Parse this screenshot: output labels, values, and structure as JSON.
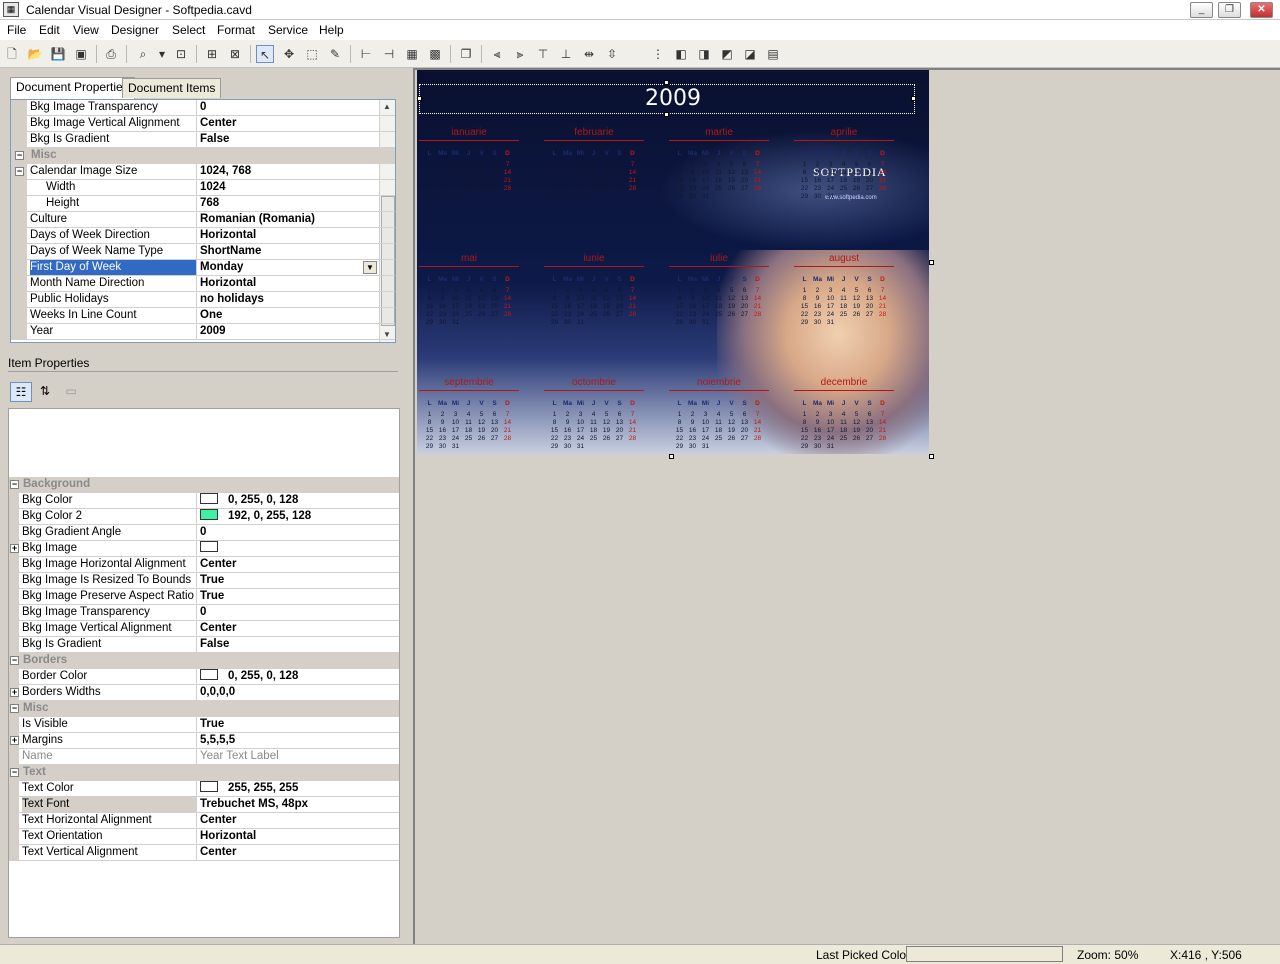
{
  "window": {
    "title": "Calendar Visual Designer - Softpedia.cavd",
    "minimize": "_",
    "maximize": "❐",
    "close": "✕"
  },
  "menu": [
    "File",
    "Edit",
    "View",
    "Designer",
    "Select",
    "Format",
    "Service",
    "Help"
  ],
  "tabs": {
    "doc_props": "Document Properties",
    "doc_items": "Document Items"
  },
  "doc_props": [
    {
      "name": "Bkg Image Transparency",
      "value": "0"
    },
    {
      "name": "Bkg Image Vertical Alignment",
      "value": "Center"
    },
    {
      "name": "Bkg Is Gradient",
      "value": "False"
    },
    {
      "name": "Misc",
      "category": true
    },
    {
      "name": "Calendar Image Size",
      "value": "1024, 768"
    },
    {
      "name": "Width",
      "value": "1024"
    },
    {
      "name": "Height",
      "value": "768"
    },
    {
      "name": "Culture",
      "value": "Romanian (Romania)"
    },
    {
      "name": "Days of Week Direction",
      "value": "Horizontal"
    },
    {
      "name": "Days of Week Name Type",
      "value": "ShortName"
    },
    {
      "name": "First Day of Week",
      "value": "Monday"
    },
    {
      "name": "Month Name Direction",
      "value": "Horizontal"
    },
    {
      "name": "Public Holidays",
      "value": "no holidays"
    },
    {
      "name": "Weeks In Line Count",
      "value": "One"
    },
    {
      "name": "Year",
      "value": "2009"
    }
  ],
  "item_props_label": "Item Properties",
  "item_props": [
    {
      "name": "Background",
      "category": true
    },
    {
      "name": "Bkg Color",
      "value": "0, 255, 0, 128",
      "swatch": "#ffffff"
    },
    {
      "name": "Bkg Color 2",
      "value": "192, 0, 255, 128",
      "swatch": "#40f0a0"
    },
    {
      "name": "Bkg Gradient Angle",
      "value": "0"
    },
    {
      "name": "Bkg Image",
      "value": "",
      "swatch": "#ffffff"
    },
    {
      "name": "Bkg Image Horizontal Alignment",
      "value": "Center"
    },
    {
      "name": "Bkg Image Is Resized To Bounds",
      "value": "True"
    },
    {
      "name": "Bkg Image Preserve Aspect Ratio",
      "value": "True"
    },
    {
      "name": "Bkg Image Transparency",
      "value": "0"
    },
    {
      "name": "Bkg Image Vertical Alignment",
      "value": "Center"
    },
    {
      "name": "Bkg Is Gradient",
      "value": "False"
    },
    {
      "name": "Borders",
      "category": true
    },
    {
      "name": "Border Color",
      "value": "0, 255, 0, 128",
      "swatch": "#ffffff"
    },
    {
      "name": "Borders Widths",
      "value": "0,0,0,0"
    },
    {
      "name": "Misc",
      "category": true
    },
    {
      "name": "Is Visible",
      "value": "True"
    },
    {
      "name": "Margins",
      "value": "5,5,5,5"
    },
    {
      "name": "Name",
      "value": "Year Text Label"
    },
    {
      "name": "Text",
      "category": true
    },
    {
      "name": "Text Color",
      "value": "255, 255, 255",
      "swatch": "#ffffff"
    },
    {
      "name": "Text Font",
      "value": "Trebuchet MS, 48px"
    },
    {
      "name": "Text Horizontal Alignment",
      "value": "Center"
    },
    {
      "name": "Text Orientation",
      "value": "Horizontal"
    },
    {
      "name": "Text Vertical Alignment",
      "value": "Center"
    }
  ],
  "calendar": {
    "year": "2009",
    "brand": "SOFTPEDIA",
    "brand_url": "www.softpedia.com",
    "weekdays": [
      "L",
      "Ma",
      "Mi",
      "J",
      "V",
      "S",
      "D"
    ],
    "months": [
      "ianuarie",
      "februarie",
      "martie",
      "aprilie",
      "mai",
      "iunie",
      "iulie",
      "august",
      "septembrie",
      "octombrie",
      "noiembrie",
      "decembrie"
    ],
    "sample_rows": [
      "1 2 3 4 5 6 7",
      "8 9 10 11 12 13 14",
      "15 16 17 18 19 20 21",
      "22 23 24 25 26 27 28",
      "29 30 31"
    ]
  },
  "status": {
    "picked_label": "Last Picked Color:",
    "zoom": "Zoom: 50%",
    "coords": "X:416 , Y:506"
  }
}
